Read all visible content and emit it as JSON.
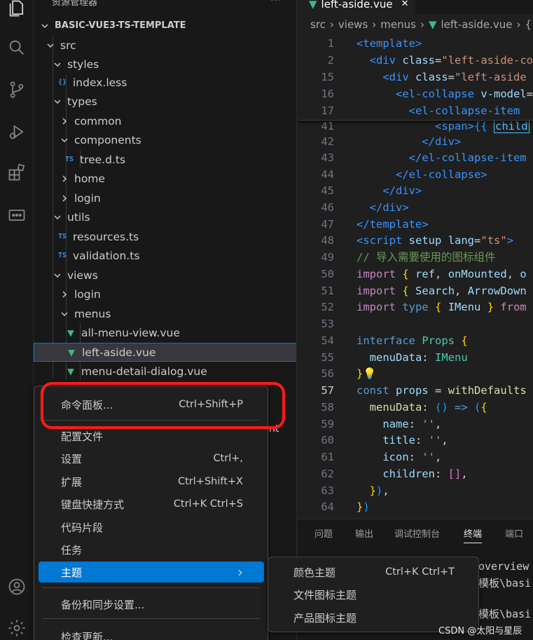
{
  "sidebar": {
    "title": "资源管理器",
    "more": "···",
    "tree": [
      {
        "label": "BASIC-VUE3-TS-TEMPLATE",
        "type": "root"
      },
      {
        "label": "src",
        "type": "folder-open"
      },
      {
        "label": "styles",
        "type": "folder-open"
      },
      {
        "label": "index.less",
        "type": "file-braces",
        "badge": "{}"
      },
      {
        "label": "types",
        "type": "folder-open"
      },
      {
        "label": "common",
        "type": "folder-closed"
      },
      {
        "label": "components",
        "type": "folder-open"
      },
      {
        "label": "tree.d.ts",
        "type": "file-ts",
        "badge": "TS"
      },
      {
        "label": "home",
        "type": "folder-closed"
      },
      {
        "label": "login",
        "type": "folder-closed"
      },
      {
        "label": "utils",
        "type": "folder-open"
      },
      {
        "label": "resources.ts",
        "type": "file-ts",
        "badge": "TS"
      },
      {
        "label": "validation.ts",
        "type": "file-ts",
        "badge": "TS"
      },
      {
        "label": "views",
        "type": "folder-open"
      },
      {
        "label": "login",
        "type": "folder-closed"
      },
      {
        "label": "menus",
        "type": "folder-open"
      },
      {
        "label": "all-menu-view.vue",
        "type": "file-vue"
      },
      {
        "label": "left-aside.vue",
        "type": "file-vue",
        "selected": true
      },
      {
        "label": "menu-detail-dialog.vue",
        "type": "file-vue"
      }
    ],
    "partial_text": "nt"
  },
  "editor": {
    "tab_label": "left-aside.vue",
    "tab_close": "✕",
    "breadcrumb": [
      "src",
      "views",
      "menus",
      "left-aside.vue",
      "{"
    ],
    "lines": [
      {
        "n": "1",
        "code": "<template>"
      },
      {
        "n": "2",
        "code": "  <div class=\"left-aside-co"
      },
      {
        "n": "15",
        "code": "    <div class=\"left-aside"
      },
      {
        "n": "16",
        "code": "      <el-collapse v-model="
      },
      {
        "n": "17",
        "code": "        <el-collapse-item "
      },
      {
        "n": "41",
        "code": "              <span>{{ child"
      },
      {
        "n": "42",
        "code": "            </div>"
      },
      {
        "n": "43",
        "code": "          </el-collapse-item"
      },
      {
        "n": "44",
        "code": "        </el-collapse>"
      },
      {
        "n": "45",
        "code": "      </div>"
      },
      {
        "n": "46",
        "code": "    </div>"
      },
      {
        "n": "47",
        "code": "</template>"
      },
      {
        "n": "48",
        "code": "<script setup lang=\"ts\">"
      },
      {
        "n": "49",
        "code": "// 导入需要使用的图标组件"
      },
      {
        "n": "50",
        "code": "import { ref, onMounted, o"
      },
      {
        "n": "51",
        "code": "import { Search, ArrowDown"
      },
      {
        "n": "52",
        "code": "import type { IMenu } from"
      },
      {
        "n": "53",
        "code": ""
      },
      {
        "n": "54",
        "code": "interface Props {"
      },
      {
        "n": "55",
        "code": "  menuData: IMenu"
      },
      {
        "n": "56",
        "code": "}"
      },
      {
        "n": "57",
        "code": "const props = withDefaults"
      },
      {
        "n": "58",
        "code": "  menuData: () => ({"
      },
      {
        "n": "59",
        "code": "    name: '',"
      },
      {
        "n": "60",
        "code": "    title: '',"
      },
      {
        "n": "61",
        "code": "    icon: '',"
      },
      {
        "n": "62",
        "code": "    children: [],"
      },
      {
        "n": "63",
        "code": "  }),"
      },
      {
        "n": "64",
        "code": "})"
      }
    ]
  },
  "panel": {
    "tabs": [
      "问题",
      "输出",
      "调试控制台",
      "终端",
      "端口"
    ],
    "active_tab": "终端",
    "terminal_lines": [
      "overview",
      "模板\\basi",
      "模板\\basi"
    ]
  },
  "context_menu": {
    "items": [
      {
        "label": "命令面板...",
        "shortcut": "Ctrl+Shift+P"
      },
      {
        "label": "配置文件",
        "shortcut": ""
      },
      {
        "label": "设置",
        "shortcut": "Ctrl+,"
      },
      {
        "label": "扩展",
        "shortcut": "Ctrl+Shift+X"
      },
      {
        "label": "键盘快捷方式",
        "shortcut": "Ctrl+K Ctrl+S"
      },
      {
        "label": "代码片段",
        "shortcut": ""
      },
      {
        "label": "任务",
        "shortcut": ""
      },
      {
        "label": "主题",
        "shortcut": "",
        "submenu": true,
        "active": true
      },
      {
        "label": "备份和同步设置...",
        "shortcut": ""
      },
      {
        "label": "检查更新...",
        "shortcut": ""
      }
    ],
    "submenu_arrow": "›"
  },
  "theme_submenu": {
    "items": [
      {
        "label": "颜色主题",
        "shortcut": "Ctrl+K Ctrl+T"
      },
      {
        "label": "文件图标主题",
        "shortcut": ""
      },
      {
        "label": "产品图标主题",
        "shortcut": ""
      }
    ]
  },
  "watermark": "CSDN @太阳与星辰",
  "colors": {
    "accent": "#0078d4",
    "highlight_ring": "#ff1a1a",
    "vue_green": "#41b883",
    "ts_blue": "#3b8eea"
  }
}
